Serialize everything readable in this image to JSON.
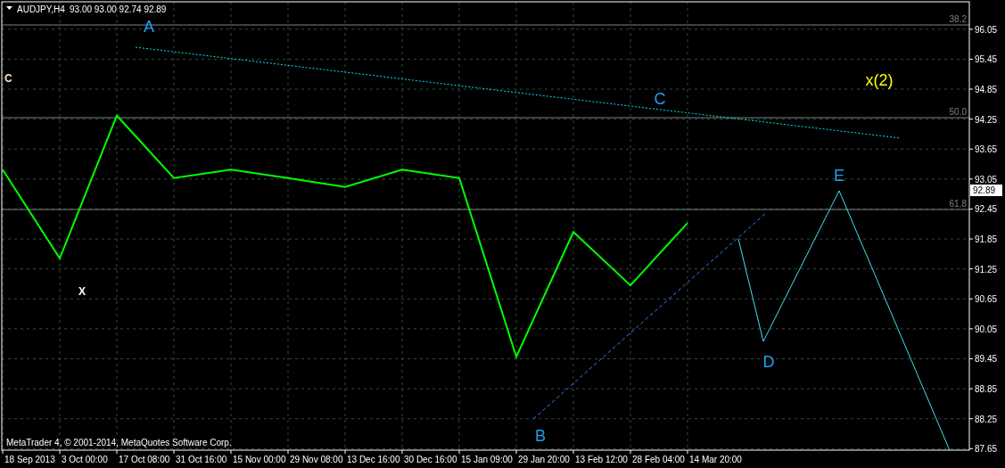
{
  "header": {
    "ohlc": "93.00 93.00 92.74 92.89"
  },
  "chart_data": {
    "type": "line",
    "grid": true,
    "categories": [
      "18 Sep 2013",
      "3 Oct 00:00",
      "17 Oct 08:00",
      "31 Oct 16:00",
      "15 Nov 00:00",
      "29 Nov 08:00",
      "13 Dec 16:00",
      "30 Dec 16:00",
      "15 Jan 09:00",
      "29 Jan 20:00",
      "13 Feb 12:00",
      "28 Feb 04:00",
      "14 Mar 20:00"
    ],
    "series": [
      {
        "name": "AUDJPY,H4",
        "color": "#00ff00",
        "values": [
          93.24,
          91.46,
          94.32,
          93.07,
          93.24,
          93.07,
          92.89,
          93.24,
          93.07,
          89.49,
          91.99,
          90.92,
          92.17
        ]
      }
    ],
    "ylim": [
      87.62,
      96.6
    ],
    "yticks": [
      {
        "value": 96.05,
        "label": "96.05"
      },
      {
        "value": 95.45,
        "label": "95.45"
      },
      {
        "value": 94.85,
        "label": "94.85"
      },
      {
        "value": 94.25,
        "label": "94.25"
      },
      {
        "value": 93.65,
        "label": "93.65"
      },
      {
        "value": 93.05,
        "label": "93.05"
      },
      {
        "value": 92.45,
        "label": "92.45"
      },
      {
        "value": 91.85,
        "label": "91.85"
      },
      {
        "value": 91.25,
        "label": "91.25"
      },
      {
        "value": 90.65,
        "label": "90.65"
      },
      {
        "value": 90.05,
        "label": "90.05"
      },
      {
        "value": 89.45,
        "label": "89.45"
      },
      {
        "value": 88.85,
        "label": "88.85"
      },
      {
        "value": 88.25,
        "label": "88.25"
      },
      {
        "value": 87.65,
        "label": "87.65"
      }
    ]
  },
  "fib_levels": [
    "38.2",
    "50.0",
    "61.8"
  ],
  "current_price": "92.89",
  "wave_labels": [
    {
      "text": "A",
      "color": "#1ea0f0"
    },
    {
      "text": "C",
      "color": "#ffe4c4"
    },
    {
      "text": "X",
      "color": "#ffffff"
    },
    {
      "text": "B",
      "color": "#1ea0f0"
    },
    {
      "text": "C",
      "color": "#1ea0f0"
    },
    {
      "text": "D",
      "color": "#1ea0f0"
    },
    {
      "text": "E",
      "color": "#1ea0f0"
    },
    {
      "text": "x(2)",
      "color": "#ffff00"
    }
  ],
  "copyright": "MetaTrader 4, © 2001-2014, MetaQuotes Software Corp."
}
